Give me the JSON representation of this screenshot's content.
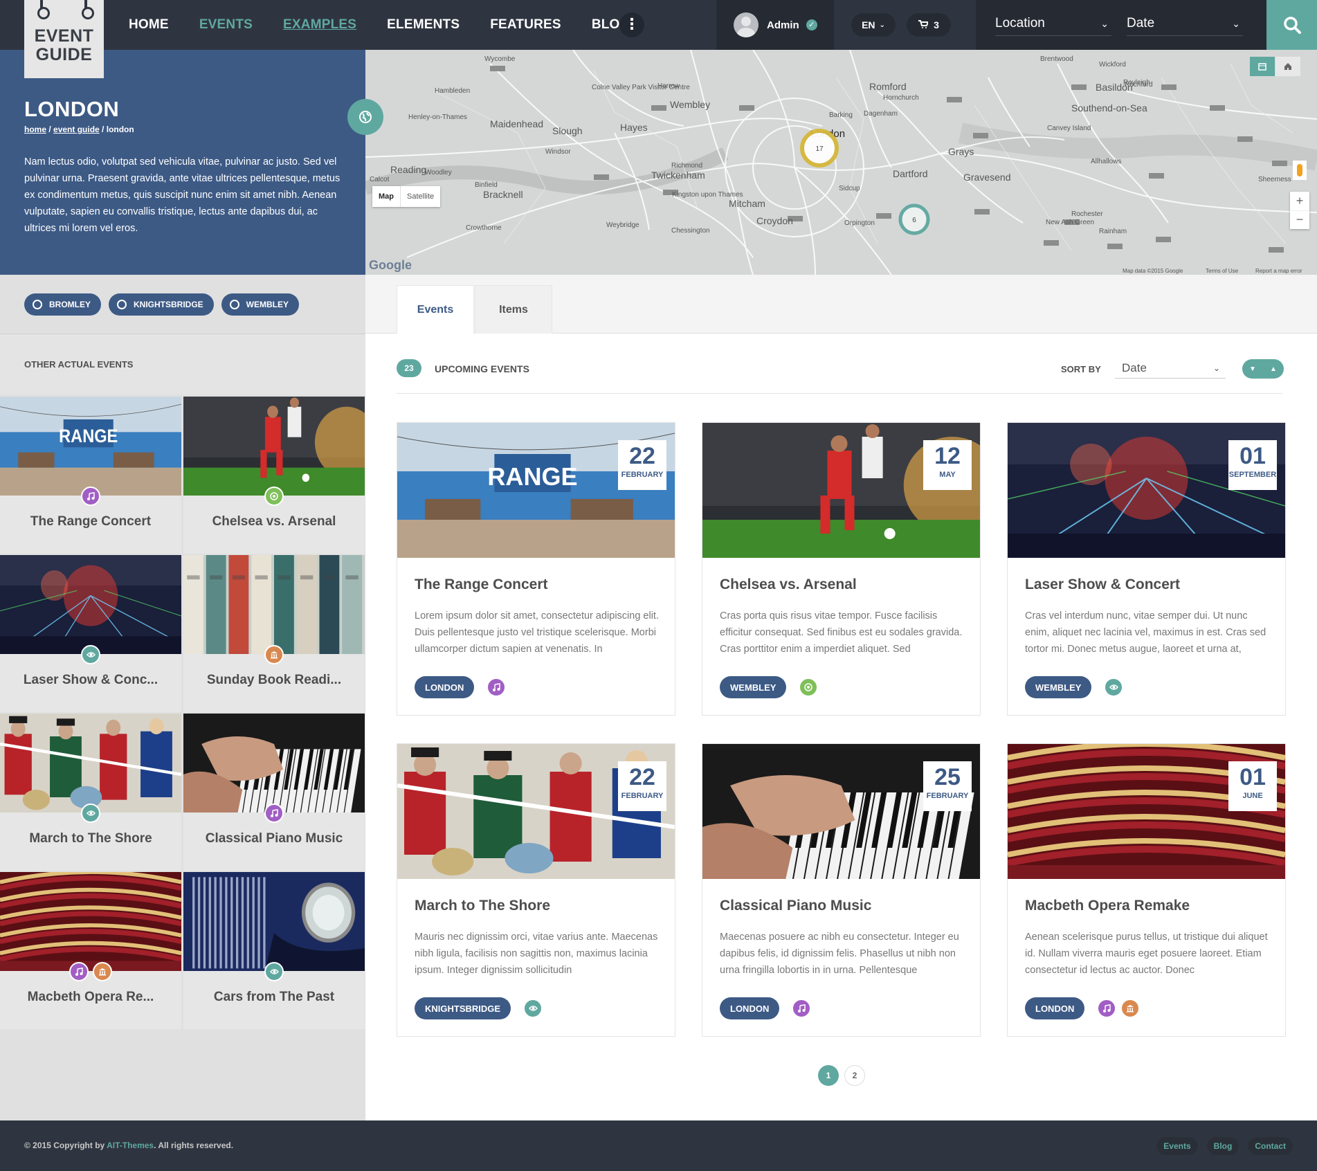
{
  "header": {
    "logo_line1": "EVENT",
    "logo_line2": "GUIDE",
    "nav": [
      {
        "label": "HOME",
        "state": "normal"
      },
      {
        "label": "EVENTS",
        "state": "active"
      },
      {
        "label": "EXAMPLES",
        "state": "hover"
      },
      {
        "label": "ELEMENTS",
        "state": "normal"
      },
      {
        "label": "FEATURES",
        "state": "normal"
      },
      {
        "label": "BLOG",
        "state": "normal"
      }
    ],
    "more_icon": "vertical-dots-icon",
    "user_name": "Admin",
    "language": "EN",
    "cart_count": "3",
    "location_label": "Location",
    "date_label": "Date"
  },
  "left": {
    "city": "LONDON",
    "breadcrumb": [
      "home",
      "event guide",
      "london"
    ],
    "description": "Nam lectus odio, volutpat sed vehicula vitae, pulvinar ac justo. Sed vel pulvinar urna. Praesent gravida, ante vitae ultrices pellentesque, metus ex condimentum metus, quis suscipit nunc enim sit amet nibh. Aenean vulputate, sapien eu convallis tristique, lectus ante dapibus dui, ac ultrices mi lorem vel eros.",
    "tags": [
      "BROMLEY",
      "KNIGHTSBRIDGE",
      "WEMBLEY"
    ],
    "other_title": "OTHER ACTUAL EVENTS",
    "other_events": [
      {
        "title": "The Range Concert",
        "badges": [
          "music"
        ]
      },
      {
        "title": "Chelsea vs. Arsenal",
        "badges": [
          "sport"
        ]
      },
      {
        "title": "Laser Show & Conc...",
        "badges": [
          "show"
        ]
      },
      {
        "title": "Sunday Book Readi...",
        "badges": [
          "culture"
        ]
      },
      {
        "title": "March to The Shore",
        "badges": [
          "show"
        ]
      },
      {
        "title": "Classical Piano Music",
        "badges": [
          "music"
        ]
      },
      {
        "title": "Macbeth Opera Re...",
        "badges": [
          "music",
          "culture"
        ]
      },
      {
        "title": "Cars from The Past",
        "badges": [
          "show"
        ]
      }
    ]
  },
  "map": {
    "type_map": "Map",
    "type_satellite": "Satellite",
    "cluster1": "17",
    "cluster2": "6",
    "places": [
      "Wycombe",
      "Hambleden",
      "Henley-on-Thames",
      "Maidenhead",
      "Slough",
      "Windsor",
      "Reading",
      "Woodley",
      "Calcot",
      "Binfield",
      "Bracknell",
      "Crowthorne",
      "Colne Valley Park Visitor Centre",
      "Harrow",
      "Wembley",
      "Hayes",
      "Richmond",
      "Twickenham",
      "Kingston upon Thames",
      "Mitcham",
      "Croydon",
      "Weybridge",
      "Chessington",
      "London",
      "Romford",
      "Hornchurch",
      "Barking",
      "Dagenham",
      "Grays",
      "Dartford",
      "Sidcup",
      "Orpington",
      "Gravesend",
      "Brentwood",
      "Wickford",
      "Basildon",
      "Rayleigh",
      "Rochford",
      "Southend-on-Sea",
      "Canvey Island",
      "Allhallows",
      "Sheerness",
      "Rochester",
      "Rainham",
      "New Ash Green"
    ],
    "attribution": [
      "Map data ©2015 Google",
      "Terms of Use",
      "Report a map error"
    ],
    "google": "Google",
    "zoom_in": "+",
    "zoom_out": "−"
  },
  "tabs": [
    "Events",
    "Items"
  ],
  "events_header": {
    "count": "23",
    "title": "UPCOMING EVENTS",
    "sort_label": "SORT BY",
    "sort_value": "Date"
  },
  "cards": [
    {
      "day": "22",
      "month": "FEBRUARY",
      "title": "The Range Concert",
      "text": "Lorem ipsum dolor sit amet, consectetur adipiscing elit. Duis pellentesque justo vel tristique scelerisque. Morbi ullamcorper dictum sapien at venenatis. In",
      "location": "LONDON",
      "badges": [
        "music"
      ]
    },
    {
      "day": "12",
      "month": "MAY",
      "title": "Chelsea vs. Arsenal",
      "text": "Cras porta quis risus vitae tempor. Fusce facilisis efficitur consequat. Sed finibus est eu sodales gravida. Cras porttitor enim a imperdiet aliquet. Sed",
      "location": "WEMBLEY",
      "badges": [
        "sport"
      ]
    },
    {
      "day": "01",
      "month": "SEPTEMBER",
      "title": "Laser Show & Concert",
      "text": "Cras vel interdum nunc, vitae semper dui. Ut nunc enim, aliquet nec lacinia vel, maximus in est. Cras sed tortor mi. Donec metus augue, laoreet et urna at,",
      "location": "WEMBLEY",
      "badges": [
        "show"
      ]
    },
    {
      "day": "22",
      "month": "FEBRUARY",
      "title": "March to The Shore",
      "text": "Mauris nec dignissim orci, vitae varius ante. Maecenas nibh ligula, facilisis non sagittis non, maximus lacinia ipsum. Integer dignissim sollicitudin",
      "location": "KNIGHTSBRIDGE",
      "badges": [
        "show"
      ]
    },
    {
      "day": "25",
      "month": "FEBRUARY",
      "title": "Classical Piano Music",
      "text": "Maecenas posuere ac nibh eu consectetur. Integer eu dapibus felis, id dignissim felis. Phasellus ut nibh non urna fringilla lobortis in in urna. Pellentesque",
      "location": "LONDON",
      "badges": [
        "music"
      ]
    },
    {
      "day": "01",
      "month": "JUNE",
      "title": "Macbeth Opera Remake",
      "text": "Aenean scelerisque purus tellus, ut tristique dui aliquet id. Nullam viverra mauris eget posuere laoreet. Etiam consectetur id lectus ac auctor. Donec",
      "location": "LONDON",
      "badges": [
        "music",
        "culture"
      ]
    }
  ],
  "pagination": [
    "1",
    "2"
  ],
  "footer": {
    "copyright_prefix": "© 2015 Copyright by ",
    "copyright_brand": "AIT-Themes",
    "copyright_suffix": ". All rights reserved.",
    "links": [
      "Events",
      "Blog",
      "Contact"
    ]
  },
  "colors": {
    "header": "#2f3540",
    "accent": "#5fa8a0",
    "blue": "#3d5a85",
    "music": "#a15ec4",
    "sport": "#7fbf5a",
    "show": "#5fa8a0",
    "culture": "#d9894f"
  }
}
